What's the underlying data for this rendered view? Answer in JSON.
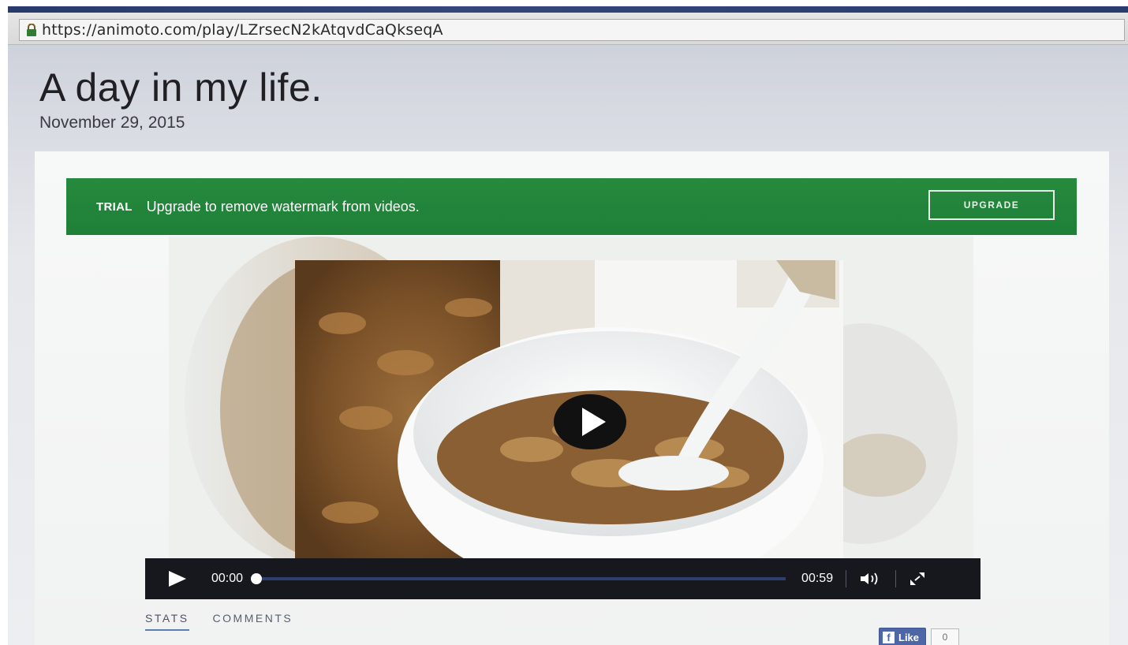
{
  "browser": {
    "url": "https://animoto.com/play/LZrsecN2kAtqvdCaQkseqA"
  },
  "page": {
    "title": "A day in my life.",
    "date": "November 29, 2015"
  },
  "trial_banner": {
    "tag": "TRIAL",
    "message": "Upgrade to remove watermark from videos.",
    "button_label": "UPGRADE",
    "color": "#268a3e"
  },
  "player": {
    "current_time": "00:00",
    "total_time": "00:59",
    "progress": 0,
    "icons": [
      "play-icon",
      "volume-icon",
      "fullscreen-icon"
    ]
  },
  "tabs": [
    {
      "label": "STATS",
      "active": true
    },
    {
      "label": "COMMENTS",
      "active": false
    }
  ],
  "facebook": {
    "icon": "f",
    "like_label": "Like",
    "count": "0",
    "color": "#4d67a6"
  }
}
